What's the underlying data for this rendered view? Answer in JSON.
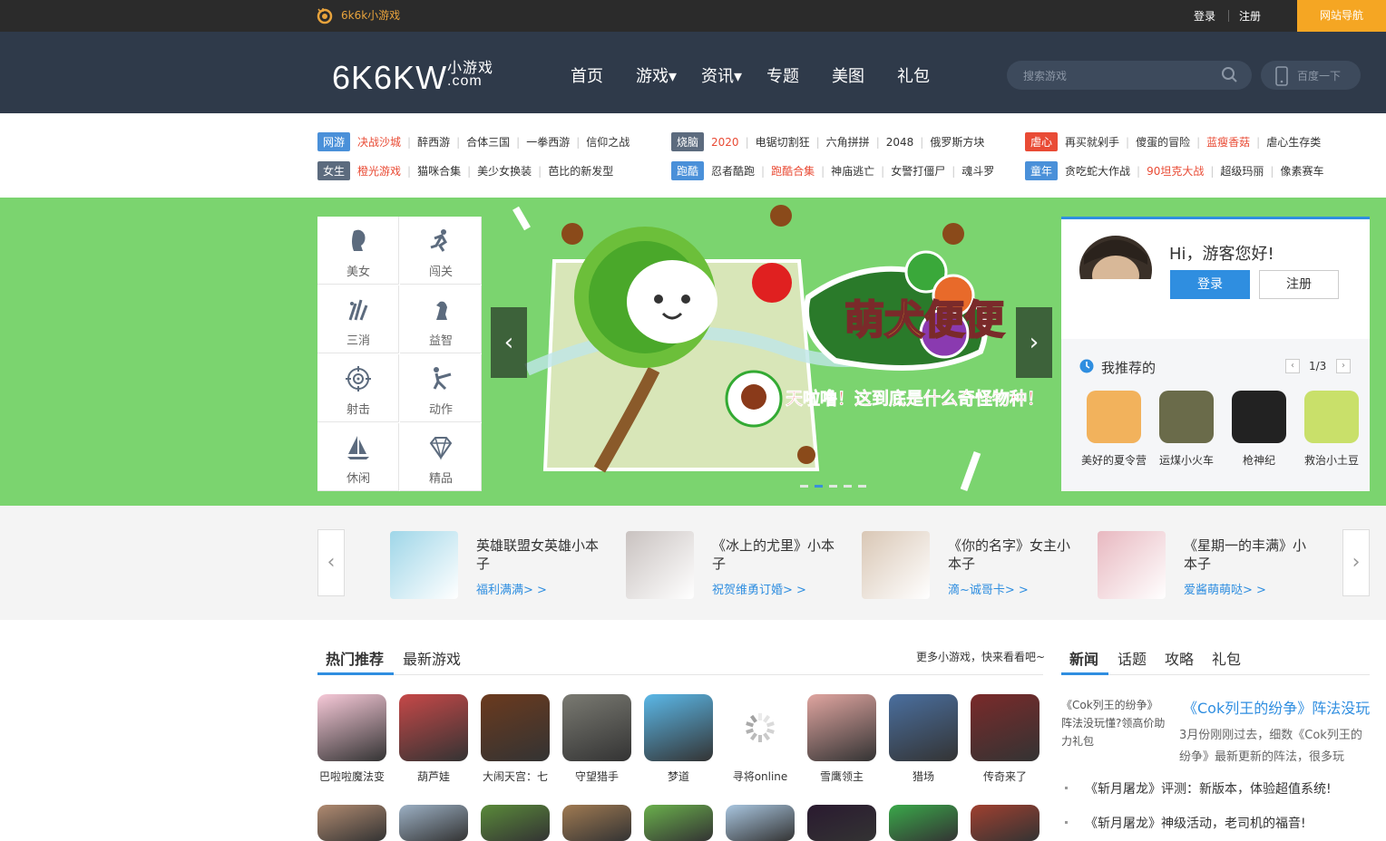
{
  "topbar": {
    "site_name": "6k6k小游戏",
    "login": "登录",
    "register": "注册",
    "site_nav": "网站导航"
  },
  "header": {
    "brand": "6K6KW",
    "brand_suffix_top": "小游戏",
    "brand_suffix_bottom": ".com",
    "nav": [
      "首页",
      "游戏▾",
      "资讯▾",
      "专题",
      "美图",
      "礼包"
    ],
    "search_placeholder": "搜索游戏",
    "baidu_placeholder": "百度一下"
  },
  "tags": [
    {
      "badge": "网游",
      "color": "#4a90d9",
      "items": [
        {
          "t": "决战沙城",
          "red": true
        },
        {
          "t": "醉西游"
        },
        {
          "t": "合体三国"
        },
        {
          "t": "一拳西游"
        },
        {
          "t": "信仰之战"
        }
      ]
    },
    {
      "badge": "烧脑",
      "color": "#5c6b7e",
      "items": [
        {
          "t": "2020",
          "red": true
        },
        {
          "t": "电锯切割狂"
        },
        {
          "t": "六角拼拼"
        },
        {
          "t": "2048"
        },
        {
          "t": "俄罗斯方块"
        }
      ]
    },
    {
      "badge": "虐心",
      "color": "#e94b35",
      "items": [
        {
          "t": "再买就剁手"
        },
        {
          "t": "傻蛋的冒险"
        },
        {
          "t": "蓝瘦香菇",
          "red": true
        },
        {
          "t": "虐心生存类"
        }
      ]
    },
    {
      "badge": "女生",
      "color": "#5c6b7e",
      "items": [
        {
          "t": "橙光游戏",
          "red": true
        },
        {
          "t": "猫咪合集"
        },
        {
          "t": "美少女换装"
        },
        {
          "t": "芭比的新发型"
        }
      ]
    },
    {
      "badge": "跑酷",
      "color": "#4a90d9",
      "items": [
        {
          "t": "忍者酷跑"
        },
        {
          "t": "跑酷合集",
          "red": true
        },
        {
          "t": "神庙逃亡"
        },
        {
          "t": "女警打僵尸"
        },
        {
          "t": "魂斗罗"
        }
      ]
    },
    {
      "badge": "童年",
      "color": "#4a90d9",
      "items": [
        {
          "t": "贪吃蛇大作战"
        },
        {
          "t": "90坦克大战",
          "red": true
        },
        {
          "t": "超级玛丽"
        },
        {
          "t": "像素赛车"
        }
      ]
    }
  ],
  "categories": [
    {
      "label": "美女",
      "icon": "beauty-icon"
    },
    {
      "label": "闯关",
      "icon": "runner-icon"
    },
    {
      "label": "三消",
      "icon": "match-icon"
    },
    {
      "label": "益智",
      "icon": "chess-icon"
    },
    {
      "label": "射击",
      "icon": "target-icon"
    },
    {
      "label": "动作",
      "icon": "kick-icon"
    },
    {
      "label": "休闲",
      "icon": "sailboat-icon"
    },
    {
      "label": "精品",
      "icon": "diamond-icon"
    }
  ],
  "slide": {
    "title": "萌犬便便",
    "tagline": "天啦噜！这到底是什么奇怪物种！",
    "dots": 5,
    "active_dot": 2
  },
  "user": {
    "greeting": "Hi，游客您好!",
    "login": "登录",
    "register": "注册",
    "rec_title": "我推荐的",
    "page": "1/3",
    "recs": [
      {
        "name": "美好的夏令营",
        "color": "#f2b25c"
      },
      {
        "name": "运煤小火车",
        "color": "#6a6b4a"
      },
      {
        "name": "枪神纪",
        "color": "#222"
      },
      {
        "name": "救治小土豆",
        "color": "#c9e06a"
      }
    ]
  },
  "strip": [
    {
      "title": "英雄联盟女英雄小本子",
      "link": "福利满满> >",
      "color": "#9fd6e8"
    },
    {
      "title": "《冰上的尤里》小本子",
      "link": "祝贺维勇订婚> >",
      "color": "#c9c2c0"
    },
    {
      "title": "《你的名字》女主小本子",
      "link": "滴~诚哥卡> >",
      "color": "#d9c7b5"
    },
    {
      "title": "《星期一的丰满》小本子",
      "link": "爱酱萌萌哒> >",
      "color": "#e8b8c0"
    }
  ],
  "hot": {
    "tab_hot": "热门推荐",
    "tab_new": "最新游戏",
    "more": "更多小游戏，快来看看吧~",
    "games": [
      {
        "name": "巴啦啦魔法变",
        "color": "#f7c9d8"
      },
      {
        "name": "葫芦娃",
        "color": "#c64848"
      },
      {
        "name": "大闹天宫：七",
        "color": "#6b3a1e"
      },
      {
        "name": "守望猎手",
        "color": "#7a7a72"
      },
      {
        "name": "梦道",
        "color": "#5bb8e8"
      },
      {
        "name": "寻将online",
        "color": "#ffffff"
      },
      {
        "name": "雪鹰领主",
        "color": "#e0a5a0"
      },
      {
        "name": "猎场",
        "color": "#4a6f9f"
      },
      {
        "name": "传奇来了",
        "color": "#7a2a2a"
      }
    ],
    "row2": [
      "#b08a70",
      "#9cb0c4",
      "#5a8a3a",
      "#a07a52",
      "#6ab04c",
      "#a9c6e0",
      "#2a1a30",
      "#3aa84a",
      "#a04030"
    ]
  },
  "news": {
    "tabs": [
      "新闻",
      "话题",
      "攻略",
      "礼包"
    ],
    "img_alt": "《Cok列王的纷争》阵法没玩懂?领高价助力礼包",
    "headline": "《Cok列王的纷争》阵法没玩",
    "desc": "3月份刚刚过去，细数《Cok列王的纷争》最新更新的阵法，很多玩",
    "items": [
      "《斩月屠龙》评测：新版本，体验超值系统!",
      "《斩月屠龙》神级活动，老司机的福音!"
    ]
  }
}
